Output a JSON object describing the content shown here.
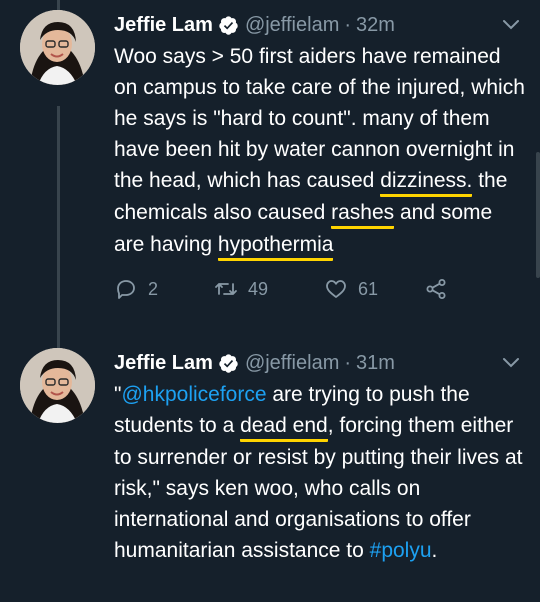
{
  "tweets": [
    {
      "name": "Jeffie Lam",
      "handle": "@jeffielam",
      "separator": "·",
      "time": "32m",
      "text": {
        "p1": "Woo says > 50 first aiders have remained on campus to take care of the injured, which he says is \"hard to count\". many of them have been hit by water cannon overnight in the head, which has caused ",
        "u1": "dizziness.",
        "p2": " the chemicals also caused ",
        "u2": "rashes",
        "p3": " and some are having ",
        "u3": "hypothermia"
      },
      "replies": "2",
      "retweets": "49",
      "likes": "61"
    },
    {
      "name": "Jeffie Lam",
      "handle": "@jeffielam",
      "separator": "·",
      "time": "31m",
      "text": {
        "q1": "\"",
        "mention": "@hkpoliceforce",
        "p1": " are trying to push the students to a ",
        "u1": "dead end",
        "p2": ", forcing them either to surrender or resist by putting their lives at risk,\" says ken woo, who calls on international and organisations to offer humanitarian assistance to ",
        "hashtag": "#polyu",
        "p3": "."
      }
    }
  ],
  "colors": {
    "background": "#15202b",
    "text": "#ffffff",
    "secondary": "#8899a6",
    "link": "#1da1f2",
    "highlight": "#ffd400",
    "verified": "#ffffff"
  },
  "icons": [
    "verified-badge-icon",
    "chevron-down-icon",
    "reply-icon",
    "retweet-icon",
    "like-icon",
    "share-icon"
  ]
}
